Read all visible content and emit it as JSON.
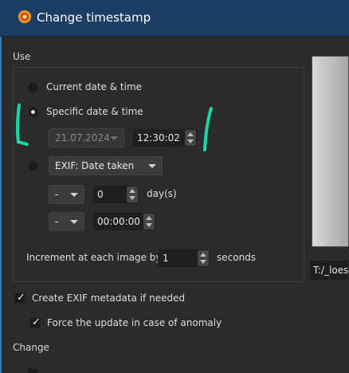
{
  "window": {
    "title": "Change timestamp"
  },
  "use_section": {
    "label": "Use",
    "current_label": "Current date & time",
    "specific_label": "Specific date & time",
    "date_value": "21.07.2024",
    "time_value": "12:30:02",
    "exif_option": "EXIF: Date taken",
    "offset_sign_1": "-",
    "offset_days_value": "0",
    "offset_days_unit": "day(s)",
    "offset_sign_2": "-",
    "offset_time_value": "00:00:00",
    "increment_label": "Increment at each image by",
    "increment_value": "1",
    "increment_unit": "seconds",
    "selected": "Specific date & time"
  },
  "options": {
    "create_exif_label": "Create EXIF metadata if needed",
    "create_exif_checked": true,
    "force_update_label": "Force the update in case of anomaly",
    "force_update_checked": true
  },
  "change_section": {
    "label": "Change"
  },
  "preview": {
    "path": "T:/_loes"
  },
  "colors": {
    "titlebar": "#1c3e63",
    "annotation": "#19d7a8",
    "background": "#2b2b2b"
  },
  "icons": {
    "app": "gear-icon",
    "dropdown": "chevron-down-icon",
    "spin": "spin-arrows-icon",
    "check": "checkmark-icon"
  }
}
